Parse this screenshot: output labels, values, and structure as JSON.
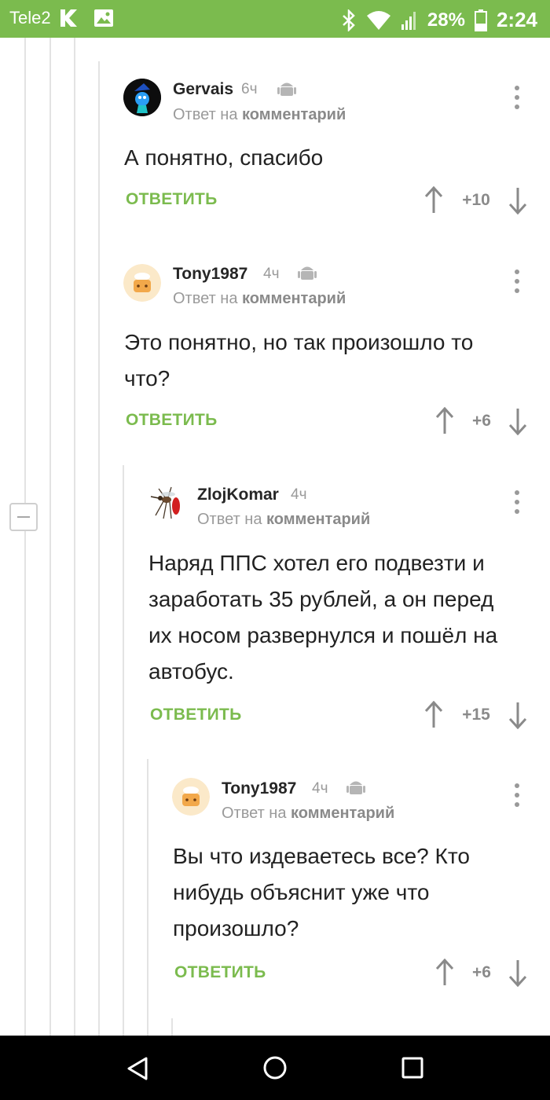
{
  "status_bar": {
    "carrier": "Tele2",
    "battery_percent": "28%",
    "time": "2:24"
  },
  "comments": [
    {
      "author": "Gervais",
      "time": "6ч",
      "reply_prefix": "Ответ на",
      "reply_target": "комментарий",
      "text": "А понятно, спасибо",
      "reply_label": "ОТВЕТИТЬ",
      "rating": "+10"
    },
    {
      "author": "Tony1987",
      "time": "4ч",
      "reply_prefix": "Ответ на",
      "reply_target": "комментарий",
      "text": "Это понятно, но так произошло то что?",
      "reply_label": "ОТВЕТИТЬ",
      "rating": "+6"
    },
    {
      "author": "ZlojKomar",
      "time": "4ч",
      "reply_prefix": "Ответ на",
      "reply_target": "комментарий",
      "text": "Наряд ППС хотел его подвезти и заработать 35 рублей, а он перед их носом развернулся и пошёл на автобус.",
      "reply_label": "ОТВЕТИТЬ",
      "rating": "+15"
    },
    {
      "author": "Tony1987",
      "time": "4ч",
      "reply_prefix": "Ответ на",
      "reply_target": "комментарий",
      "text": "Вы что издеваетесь все? Кто нибудь объяснит уже что произошло?",
      "reply_label": "ОТВЕТИТЬ",
      "rating": "+6"
    }
  ]
}
